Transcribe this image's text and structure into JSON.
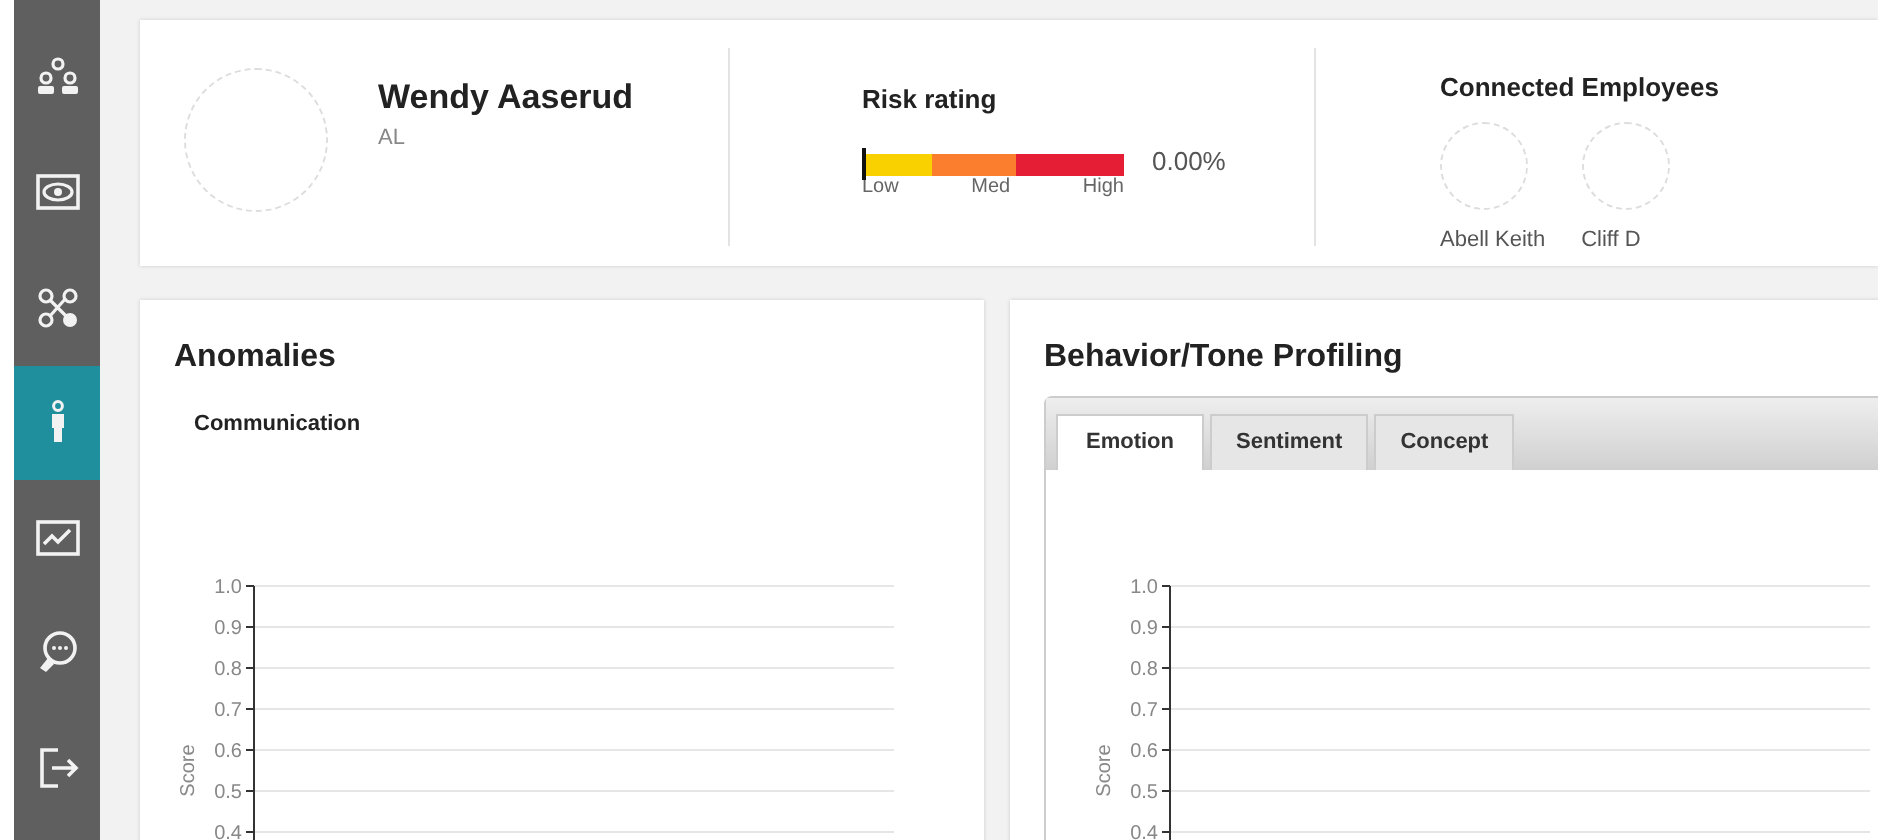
{
  "sidebar": {
    "items": [
      {
        "selected": false
      },
      {
        "selected": false
      },
      {
        "selected": false
      },
      {
        "selected": true
      },
      {
        "selected": false
      },
      {
        "selected": false
      },
      {
        "selected": false
      }
    ]
  },
  "profile": {
    "name": "Wendy Aaserud",
    "subtitle": "AL"
  },
  "risk": {
    "title": "Risk rating",
    "level": 0,
    "reading": "0.00%",
    "scale_labels": [
      "Low",
      "Med",
      "High"
    ]
  },
  "connected": {
    "title": "Connected Employees",
    "employees": [
      {
        "name": "Abell Keith"
      },
      {
        "name": "Cliff D"
      }
    ]
  },
  "anomalies": {
    "title": "Anomalies",
    "subtitle": "Communication",
    "empty_chart": {
      "axis_title": "Score",
      "axis_labels": [
        "1.0",
        "0.9",
        "0.8",
        "0.7",
        "0.6",
        "0.5",
        "0.4"
      ]
    }
  },
  "behavior": {
    "title": "Behavior/Tone Profiling",
    "tabs": [
      {
        "label": "Emotion",
        "selected": true
      },
      {
        "label": "Sentiment",
        "selected": false
      },
      {
        "label": "Concept",
        "selected": false
      }
    ],
    "empty_chart": {
      "axis_title": "Score",
      "axis_labels": [
        "1.0",
        "0.9",
        "0.8",
        "0.7",
        "0.6",
        "0.5",
        "0.4"
      ]
    }
  }
}
